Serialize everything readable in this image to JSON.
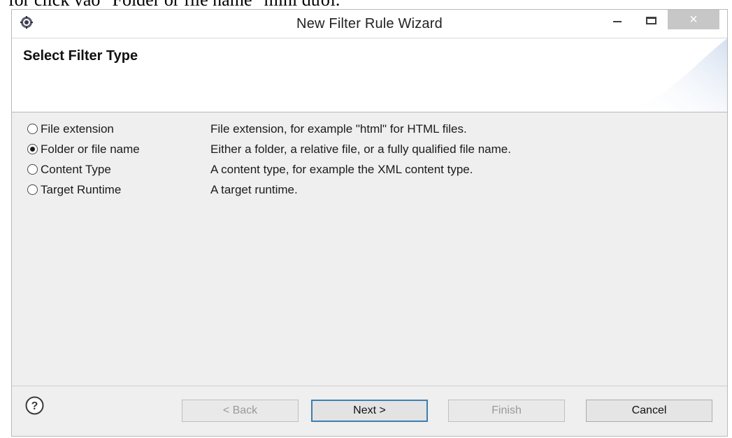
{
  "caption": "for click vào \"Folder or file name\" mini dưới.",
  "window": {
    "title": "New Filter Rule Wizard",
    "close_glyph": "×"
  },
  "banner": {
    "title": "Select Filter Type"
  },
  "options": [
    {
      "label": "File extension",
      "description": "File extension, for example \"html\" for HTML files.",
      "selected": false
    },
    {
      "label": "Folder or file name",
      "description": "Either a folder, a relative file, or a fully qualified file name.",
      "selected": true
    },
    {
      "label": "Content Type",
      "description": "A content type, for example the XML content type.",
      "selected": false
    },
    {
      "label": "Target Runtime",
      "description": "A target runtime.",
      "selected": false
    }
  ],
  "footer": {
    "help_glyph": "?",
    "back_label": "< Back",
    "next_label": "Next >",
    "finish_label": "Finish",
    "cancel_label": "Cancel"
  },
  "colors": {
    "accent": "#3c7fb1",
    "close_button_bg": "#c7c7c7",
    "disabled_text": "#9a9a9a"
  },
  "icons": {
    "app": "eclipse-gear-icon",
    "help": "question-circle-icon",
    "minimize": "minimize-icon",
    "maximize": "maximize-icon",
    "close": "close-icon"
  }
}
